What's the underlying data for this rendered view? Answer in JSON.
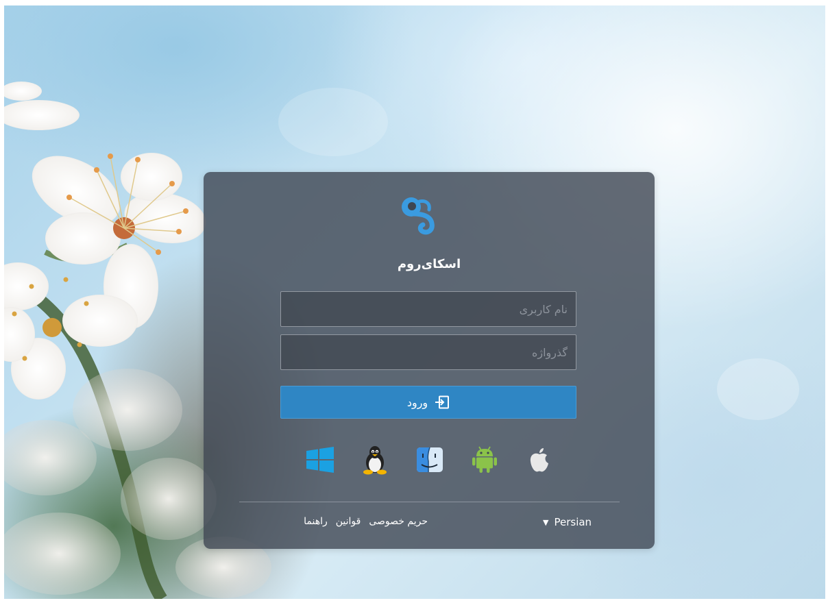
{
  "app": {
    "title": "اسکای‌روم"
  },
  "login": {
    "username_placeholder": "نام کاربری",
    "password_placeholder": "گذرواژه",
    "username_value": "",
    "password_value": "",
    "submit_label": "ورود",
    "submit_icon": "sign-in-icon"
  },
  "platforms": [
    {
      "name": "windows",
      "icon": "windows-icon",
      "color": "#1ba1e2"
    },
    {
      "name": "linux",
      "icon": "linux-icon",
      "color": "#f4b400"
    },
    {
      "name": "mac",
      "icon": "finder-icon",
      "color": "#5aa0e8"
    },
    {
      "name": "android",
      "icon": "android-icon",
      "color": "#8bc34a"
    },
    {
      "name": "ios",
      "icon": "apple-icon",
      "color": "#e8e8e8"
    }
  ],
  "footer": {
    "language": "Persian",
    "links": [
      "راهنما",
      "قوانین",
      "حریم خصوصی"
    ]
  },
  "colors": {
    "accent": "#2f86c4",
    "logo": "#3a9be0",
    "card_bg": "#3e4652"
  }
}
